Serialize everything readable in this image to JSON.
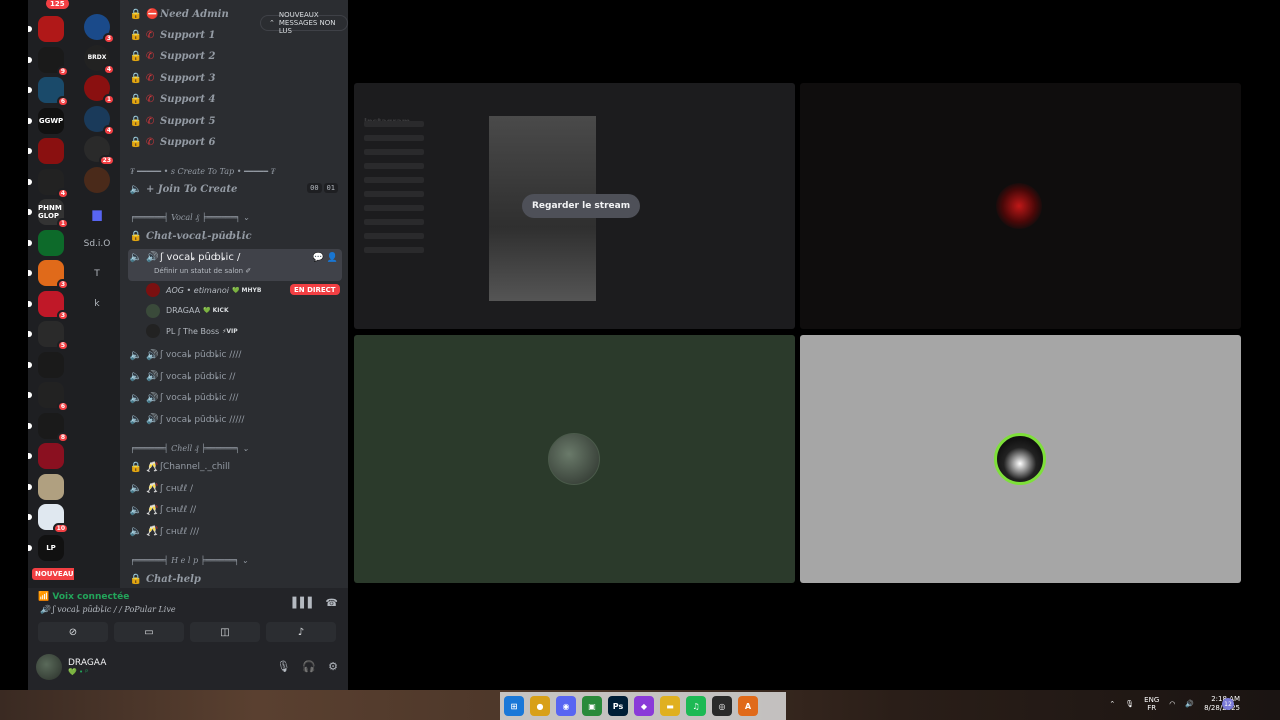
{
  "rail": {
    "top_badge": "125",
    "new_label": "NOUVEAU",
    "servers": [
      {
        "color": "#b01818",
        "badge": ""
      },
      {
        "color": "#1a1a1a",
        "badge": "9"
      },
      {
        "color": "#1a4a6a",
        "badge": "6"
      },
      {
        "color": "#111111",
        "badge": "",
        "text": "GGWP"
      },
      {
        "color": "#8a1010",
        "badge": ""
      },
      {
        "color": "#222222",
        "badge": "4"
      },
      {
        "color": "#333333",
        "badge": "1",
        "text": "PHNM GLOP"
      },
      {
        "color": "#0d6a2a",
        "badge": ""
      },
      {
        "color": "#e06a1a",
        "badge": "3"
      },
      {
        "color": "#c01828",
        "badge": "3"
      },
      {
        "color": "#2a2a2a",
        "badge": "5"
      },
      {
        "color": "#1a1a1a",
        "badge": ""
      },
      {
        "color": "#222222",
        "badge": "6"
      },
      {
        "color": "#1a1a1a",
        "badge": "8"
      },
      {
        "color": "#8a1020",
        "badge": ""
      },
      {
        "color": "#b0a080",
        "badge": ""
      },
      {
        "color": "#e0e8f0",
        "badge": "10"
      },
      {
        "color": "#111111",
        "badge": "",
        "text": "LP"
      }
    ]
  },
  "folders": {
    "items": [
      {
        "color": "#1a4a8a",
        "badge": "3"
      },
      {
        "color": "#222222",
        "badge": "4",
        "text": "BRDX"
      },
      {
        "color": "#8a1010",
        "badge": "1"
      },
      {
        "color": "#1a3a5a",
        "badge": "4"
      },
      {
        "color": "#2a2a2a",
        "badge": "23"
      },
      {
        "color": "#4a2a1a",
        "badge": ""
      }
    ],
    "text_items": [
      "Sd.i.O",
      "T",
      "k"
    ]
  },
  "channels": {
    "unread_pill": "NOUVEAUX MESSAGES NON LUS",
    "top_partial": "Need Admin",
    "support": [
      "Support 1",
      "Support 2",
      "Support 3",
      "Support 4",
      "Support 5",
      "Support 6"
    ],
    "cat_create": "₮ ━━━━━ • ꜱ Create To Tap • ━━━━━ ₮",
    "join_create": "+ Join To Create",
    "join_counts": [
      "00",
      "01"
    ],
    "cat_vocal": "╒══════╡ Vocal ₰ ╞══════╕",
    "chat_vocal": "Chat-vocaȴ-pȗȸȴic",
    "active_channel": "ʃ vocaȴ pȗȸȴic /",
    "active_sub": "Définir un statut de salon ✐",
    "users": [
      {
        "name": "AOG • etimanoi",
        "tag": "💚 MHYB",
        "color": "#7a1010"
      },
      {
        "name": "DRAGAA",
        "tag": "💚 KICK",
        "color": "#3a4a3a"
      },
      {
        "name": "PL ʃ The Boss",
        "tag": "⚡VIP",
        "color": "#222222"
      }
    ],
    "live": "EN DIRECT",
    "vocal_channels": [
      "ʃ vocaȴ pȗȸȴic ////",
      "ʃ vocaȴ pȗȸȴic //",
      "ʃ vocaȴ pȗȸȴic ///",
      "ʃ vocaȴ pȗȸȴic /////"
    ],
    "cat_chill": "╒══════╡ Chell ₰ ╞══════╕",
    "chill_channels": [
      "ʃChannel_._chill",
      "ʃ cнιℓℓ /",
      "ʃ cнιℓℓ //",
      "ʃ cнιℓℓ ///"
    ],
    "cat_help": "╒══════╡ H e l p ╞══════╕",
    "chat_help": "Chat-help"
  },
  "voice": {
    "status": "Voix connectée",
    "channel": "ʃ vocaȴ pȗȸȴic / / PoPular Live",
    "user_name": "DRAGAA",
    "user_sub": "💚 • ᵖ"
  },
  "stream": {
    "watch_label": "Regarder le stream",
    "ig_title": "Instagram"
  },
  "taskbar": {
    "lang_top": "ENG",
    "lang_bottom": "FR",
    "time": "2:18 AM",
    "date": "8/28/2025",
    "notif": "12",
    "apps": [
      {
        "label": "⊞",
        "color": "#1a78d8"
      },
      {
        "label": "●",
        "color": "#d8a018"
      },
      {
        "label": "◉",
        "color": "#5865f2"
      },
      {
        "label": "▣",
        "color": "#2a8a3a"
      },
      {
        "label": "Ps",
        "color": "#001e36"
      },
      {
        "label": "◆",
        "color": "#8a3ad8"
      },
      {
        "label": "▬",
        "color": "#e0b020"
      },
      {
        "label": "♫",
        "color": "#1db954"
      },
      {
        "label": "◎",
        "color": "#2a2a2a"
      },
      {
        "label": "A",
        "color": "#e06a1a"
      }
    ]
  }
}
